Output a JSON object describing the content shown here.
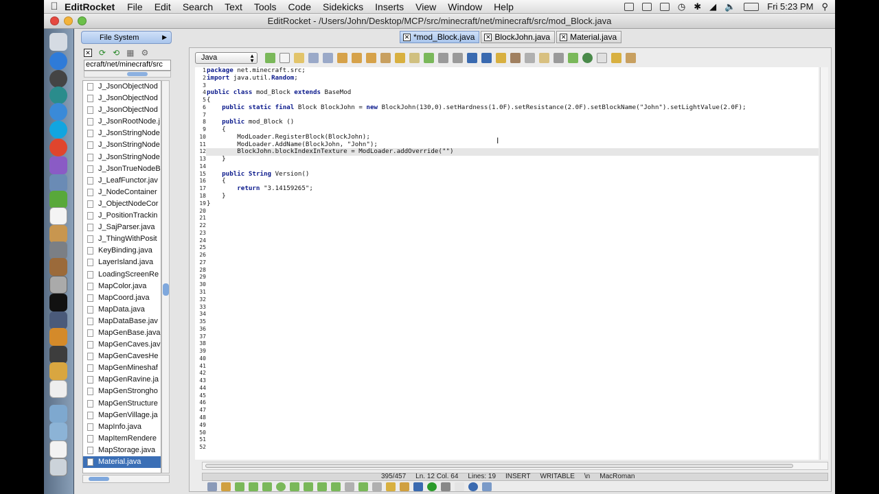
{
  "menubar": {
    "app": "EditRocket",
    "items": [
      "File",
      "Edit",
      "Search",
      "Text",
      "Tools",
      "Code",
      "Sidekicks",
      "Inserts",
      "View",
      "Window",
      "Help"
    ],
    "clock": "Fri 5:23 PM"
  },
  "window": {
    "title": "EditRocket - /Users/John/Desktop/MCP/src/minecraft/net/minecraft/src/mod_Block.java"
  },
  "sidebar": {
    "header": "File System",
    "path": "ecraft/net/minecraft/src",
    "files": [
      "J_JsonObjectNod",
      "J_JsonObjectNod",
      "J_JsonObjectNod",
      "J_JsonRootNode.j",
      "J_JsonStringNode",
      "J_JsonStringNode",
      "J_JsonStringNode",
      "J_JsonTrueNodeB",
      "J_LeafFunctor.jav",
      "J_NodeContainer",
      "J_ObjectNodeCor",
      "J_PositionTrackin",
      "J_SajParser.java",
      "J_ThingWithPosit",
      "KeyBinding.java",
      "LayerIsland.java",
      "LoadingScreenRe",
      "MapColor.java",
      "MapCoord.java",
      "MapData.java",
      "MapDataBase.jav",
      "MapGenBase.java",
      "MapGenCaves.jav",
      "MapGenCavesHe",
      "MapGenMineshaf",
      "MapGenRavine.ja",
      "MapGenStrongho",
      "MapGenStructure",
      "MapGenVillage.ja",
      "MapInfo.java",
      "MapItemRendere",
      "MapStorage.java",
      "Material.java"
    ],
    "selected_file": "Material.java"
  },
  "tabs": [
    {
      "label": "*mod_Block.java",
      "active": true
    },
    {
      "label": "BlockJohn.java",
      "active": false
    },
    {
      "label": "Material.java",
      "active": false
    }
  ],
  "editor": {
    "language": "Java",
    "line_count_visible": 52,
    "current_line": 12
  },
  "code": [
    "package net.minecraft.src;",
    "import java.util.Random;",
    "",
    "public class mod_Block extends BaseMod",
    "{",
    "    public static final Block BlockJohn = new BlockJohn(130,0).setHardness(1.0F).setResistance(2.0F).setBlockName(\"John\").setLightValue(2.0F);",
    "",
    "    public mod_Block ()",
    "    {",
    "        ModLoader.RegisterBlock(BlockJohn);",
    "        ModLoader.AddName(BlockJohn, \"John\");",
    "        BlockJohn.blockIndexInTexture = ModLoader.addOverride(\"\")",
    "    }",
    "",
    "    public String Version()",
    "    {",
    "        return \"3.14159265\";",
    "    }",
    "}"
  ],
  "status": {
    "chars": "395/457",
    "position": "Ln. 12 Col. 64",
    "lines": "Lines: 19",
    "mode": "INSERT",
    "writable": "WRITABLE",
    "eol": "\\n",
    "encoding": "MacRoman"
  }
}
